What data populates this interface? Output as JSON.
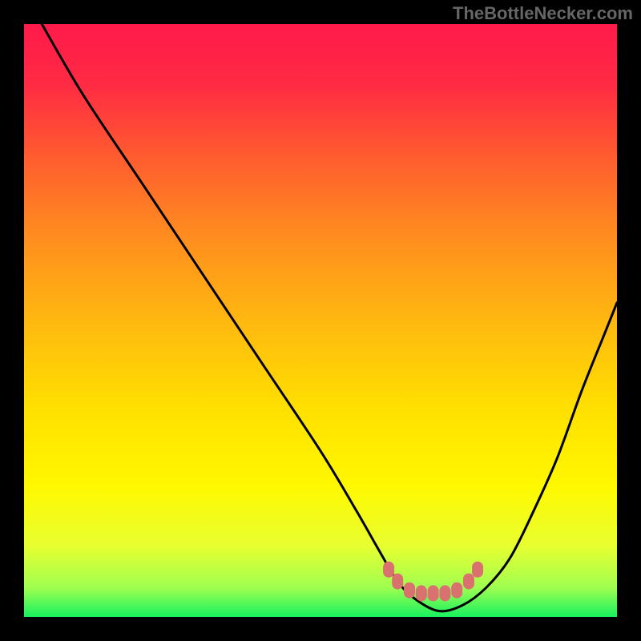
{
  "watermark": "TheBottleNecker.com",
  "chart_data": {
    "type": "line",
    "title": "",
    "xlabel": "",
    "ylabel": "",
    "xlim": [
      0,
      100
    ],
    "ylim": [
      0,
      100
    ],
    "curve": {
      "x": [
        3,
        10,
        20,
        30,
        40,
        50,
        56,
        60,
        63,
        66,
        70,
        74,
        78,
        82,
        86,
        90,
        94,
        98,
        100
      ],
      "y": [
        100,
        88,
        73,
        58,
        43,
        28,
        18,
        11,
        6,
        3,
        1,
        2,
        5,
        10,
        18,
        27,
        38,
        48,
        53
      ]
    },
    "markers": {
      "x": [
        61.5,
        63,
        65,
        67,
        69,
        71,
        73,
        75,
        76.5
      ],
      "y": [
        8,
        6,
        4.5,
        4,
        4,
        4,
        4.5,
        6,
        8
      ],
      "color": "#d9716e"
    },
    "gradient_stops": [
      {
        "offset": 0.0,
        "color": "#ff1a4a"
      },
      {
        "offset": 0.1,
        "color": "#ff2a44"
      },
      {
        "offset": 0.22,
        "color": "#ff5a30"
      },
      {
        "offset": 0.35,
        "color": "#ff8a20"
      },
      {
        "offset": 0.5,
        "color": "#ffb810"
      },
      {
        "offset": 0.65,
        "color": "#ffe000"
      },
      {
        "offset": 0.78,
        "color": "#fff800"
      },
      {
        "offset": 0.88,
        "color": "#e8ff30"
      },
      {
        "offset": 0.95,
        "color": "#a0ff50"
      },
      {
        "offset": 1.0,
        "color": "#18f060"
      }
    ]
  }
}
